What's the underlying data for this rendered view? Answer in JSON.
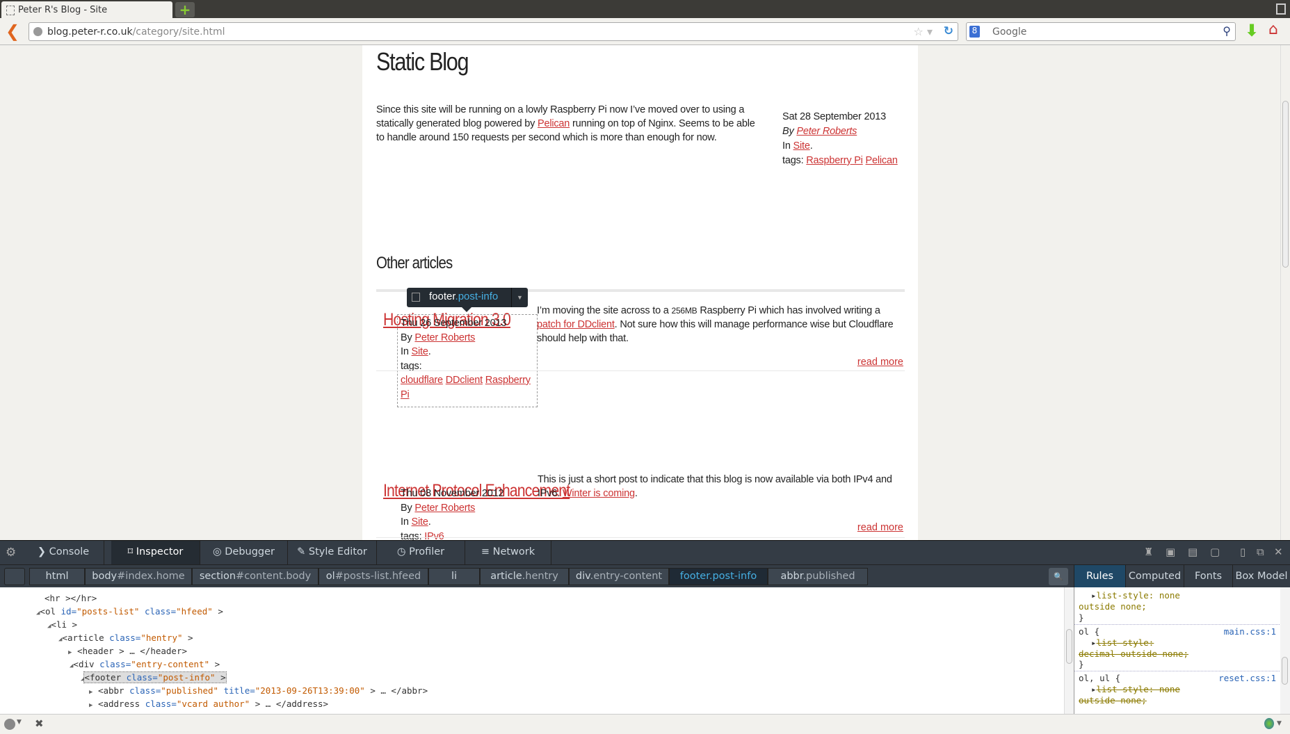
{
  "browser": {
    "tab_title": "Peter R's Blog - Site",
    "new_tab": "+",
    "url_host": "blog.peter-r.co.uk",
    "url_path": "/category/site.html",
    "search_placeholder": "Google",
    "search_engine_icon": "8"
  },
  "post": {
    "title": "Static Blog",
    "body_1": "Since this site will be running on a lowly Raspberry Pi now I’ve moved over to using a statically generated blog powered by ",
    "body_link": "Pelican",
    "body_2": " running on top of Nginx. Seems to be able to handle around 150 requests per second which is more than enough for now.",
    "date": "Sat 28 September 2013",
    "by_label": "By",
    "author": "Peter Roberts",
    "in_label": "In",
    "category": "Site",
    "tags_label": "tags:",
    "tags": [
      "Raspberry Pi",
      "Pelican"
    ]
  },
  "other": {
    "heading": "Other articles",
    "articles": [
      {
        "title": "Hosting Migration 3.0",
        "date": "Thu 26 September 2013",
        "by_label": "By",
        "author": "Peter Roberts",
        "in_label": "In",
        "category": "Site",
        "tags_label": "tags:",
        "tags": [
          "cloudflare",
          "DDclient",
          "Raspberry Pi"
        ],
        "body_1": "I’m moving the site across to a ",
        "body_small": "256MB",
        "body_2": " Raspberry Pi which has involved writing a ",
        "body_link": "patch for DDclient",
        "body_3": ". Not sure how this will manage performance wise but Cloudflare should help with that.",
        "read_more": "read more"
      },
      {
        "title": "Internet Protocol Enhancement",
        "date": "Thu 08 November 2012",
        "by_label": "By",
        "author": "Peter Roberts",
        "in_label": "In",
        "category": "Site",
        "tags_label": "tags:",
        "tags": [
          "IPv6"
        ],
        "body_1": "This is just a short post to indicate that this blog is now available via both IPv4 and IPv6. ",
        "body_link": "Winter is coming",
        "body_3": ".",
        "read_more": "read more"
      }
    ]
  },
  "infobar": {
    "tag": "footer",
    "cls": ".post-info"
  },
  "devtools": {
    "tabs": [
      "Console",
      "Inspector",
      "Debugger",
      "Style Editor",
      "Profiler",
      "Network"
    ],
    "breadcrumbs": [
      [
        "html",
        ""
      ],
      [
        "body",
        "#index.home"
      ],
      [
        "section",
        "#content.body"
      ],
      [
        "ol",
        "#posts-list.hfeed"
      ],
      [
        "li",
        ""
      ],
      [
        "article",
        ".hentry"
      ],
      [
        "div",
        ".entry-content"
      ],
      [
        "footer",
        ".post-info"
      ],
      [
        "abbr",
        ".published"
      ]
    ],
    "side_tabs": [
      "Rules",
      "Computed",
      "Fonts",
      "Box Model"
    ],
    "markup": [
      {
        "pre": "",
        "tw": "",
        "tag": "<hr ></hr>"
      },
      {
        "tw": "◢",
        "open": "<ol ",
        "a1": "id=",
        "v1": "\"posts-list\"",
        "a2": " class=",
        "v2": "\"hfeed\"",
        "close": " >"
      },
      {
        "tw": "◢",
        "open": "<li ",
        "close": ">"
      },
      {
        "tw": "◢",
        "open": "<article ",
        "a1": "class=",
        "v1": "\"hentry\"",
        "close": " >"
      },
      {
        "tw": "▶",
        "open": "<header ",
        "close": "> … </header>"
      },
      {
        "tw": "◢",
        "open": "<div ",
        "a1": "class=",
        "v1": "\"entry-content\"",
        "close": " >"
      },
      {
        "tw": "◢",
        "open": "<footer ",
        "a1": "class=",
        "v1": "\"post-info\"",
        "close": " >"
      },
      {
        "tw": "▶",
        "open": "<abbr ",
        "a1": "class=",
        "v1": "\"published\"",
        "a2": " title=",
        "v2": "\"2013-09-26T13:39:00\"",
        "close": " > … </abbr>"
      },
      {
        "tw": "▶",
        "open": "<address ",
        "a1": "class=",
        "v1": "\"vcard author\"",
        "close": " > … </address>"
      }
    ],
    "rules": {
      "r0_prop": "list-style",
      "r0_val": ": none",
      "r0_val2": "outside none;",
      "brace_close": "}",
      "r1_sel": "ol {",
      "r1_src": "main.css:1",
      "r1_prop": "list-style:",
      "r1_val": "decimal outside none;",
      "r2_sel": "ol, ul {",
      "r2_src": "reset.css:1",
      "r2_prop": "list-style: none",
      "r2_val": "outside none;"
    }
  }
}
